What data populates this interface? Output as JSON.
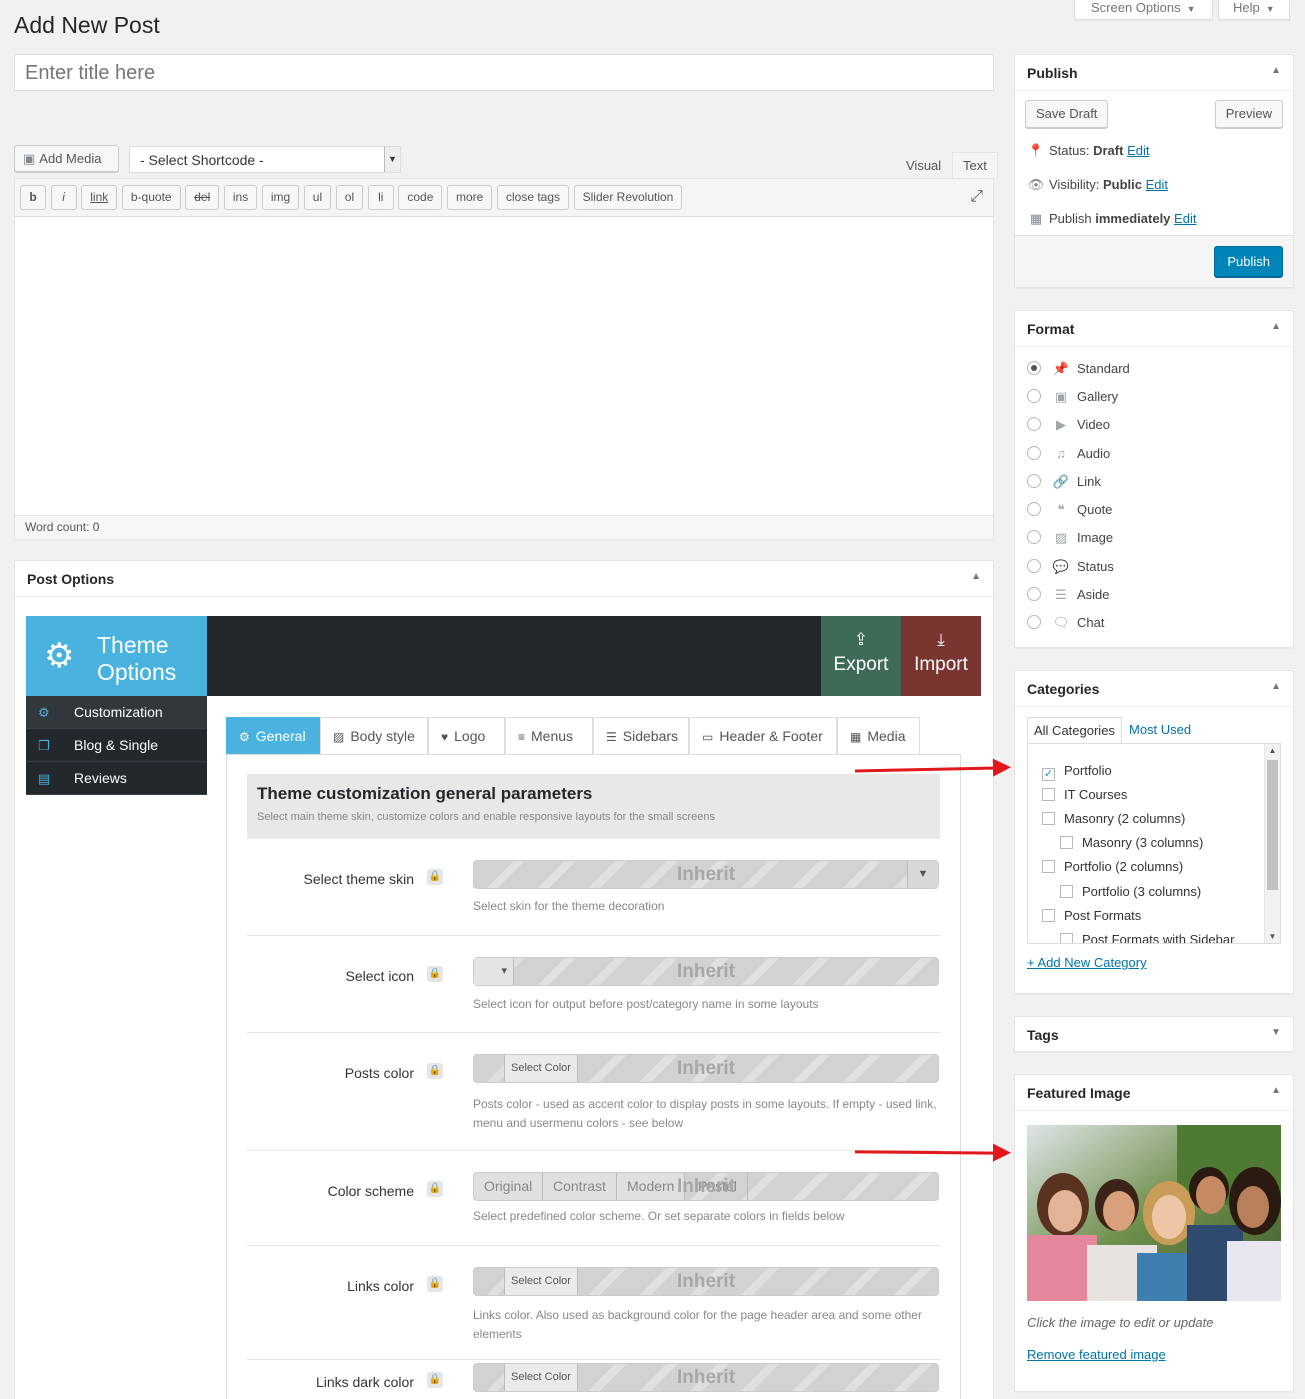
{
  "page": {
    "title": "Add New Post",
    "screen_options": "Screen Options",
    "help": "Help"
  },
  "post_title": {
    "placeholder": "Enter title here"
  },
  "editor": {
    "add_media": "Add Media",
    "shortcode_select": "- Select Shortcode -",
    "tab_visual": "Visual",
    "tab_text": "Text",
    "quicktags": [
      "b",
      "i",
      "link",
      "b-quote",
      "del",
      "ins",
      "img",
      "ul",
      "ol",
      "li",
      "code",
      "more",
      "close tags",
      "Slider Revolution"
    ],
    "word_count": "Word count: 0"
  },
  "post_options": {
    "title": "Post Options",
    "theme_options": {
      "logo_line1": "Theme",
      "logo_line2": "Options",
      "export": "Export",
      "import": "Import",
      "menu": [
        "Customization",
        "Blog & Single",
        "Reviews"
      ],
      "tabs": [
        "General",
        "Body style",
        "Logo",
        "Menus",
        "Sidebars",
        "Header & Footer",
        "Media"
      ],
      "section_title": "Theme customization general parameters",
      "section_desc": "Select main theme skin, customize colors and enable responsive layouts for the small screens",
      "inherit": "Inherit",
      "select_color": "Select Color",
      "rows": [
        {
          "label": "Select theme skin",
          "desc": "Select skin for the theme decoration"
        },
        {
          "label": "Select icon",
          "desc": "Select icon for output before post/category name in some layouts"
        },
        {
          "label": "Posts color",
          "desc": "Posts color - used as accent color to display posts in some layouts. If empty - used link, menu and usermenu colors - see below"
        },
        {
          "label": "Color scheme",
          "desc": "Select predefined color scheme. Or set separate colors in fields below"
        },
        {
          "label": "Links color",
          "desc": "Links color. Also used as background color for the page header area and some other elements"
        },
        {
          "label": "Links dark color",
          "desc": ""
        }
      ],
      "color_schemes": [
        "Original",
        "Contrast",
        "Modern",
        "Pastel"
      ]
    }
  },
  "publish": {
    "title": "Publish",
    "save_draft": "Save Draft",
    "preview": "Preview",
    "status_label": "Status:",
    "status_value": "Draft",
    "visibility_label": "Visibility:",
    "visibility_value": "Public",
    "publish_label": "Publish",
    "publish_value": "immediately",
    "edit": "Edit",
    "publish_button": "Publish"
  },
  "format": {
    "title": "Format",
    "options": [
      "Standard",
      "Gallery",
      "Video",
      "Audio",
      "Link",
      "Quote",
      "Image",
      "Status",
      "Aside",
      "Chat"
    ],
    "selected": "Standard"
  },
  "categories": {
    "title": "Categories",
    "tab_all": "All Categories",
    "tab_most_used": "Most Used",
    "items": [
      {
        "name": "Portfolio",
        "checked": true,
        "level": 0
      },
      {
        "name": "IT Courses",
        "checked": false,
        "level": 0
      },
      {
        "name": "Masonry (2 columns)",
        "checked": false,
        "level": 0
      },
      {
        "name": "Masonry (3 columns)",
        "checked": false,
        "level": 1
      },
      {
        "name": "Portfolio (2 columns)",
        "checked": false,
        "level": 0
      },
      {
        "name": "Portfolio (3 columns)",
        "checked": false,
        "level": 1
      },
      {
        "name": "Post Formats",
        "checked": false,
        "level": 0
      },
      {
        "name": "Post Formats with Sidebar",
        "checked": false,
        "level": 1
      }
    ],
    "add_new": "+ Add New Category"
  },
  "tags": {
    "title": "Tags"
  },
  "featured_image": {
    "title": "Featured Image",
    "hint": "Click the image to edit or update",
    "remove": "Remove featured image"
  },
  "colors": {
    "theme_blue": "#4ab2de",
    "export_green": "#3d6b56",
    "import_red": "#7a3530",
    "wp_blue": "#0085ba",
    "arrow_red": "#e2171a"
  }
}
